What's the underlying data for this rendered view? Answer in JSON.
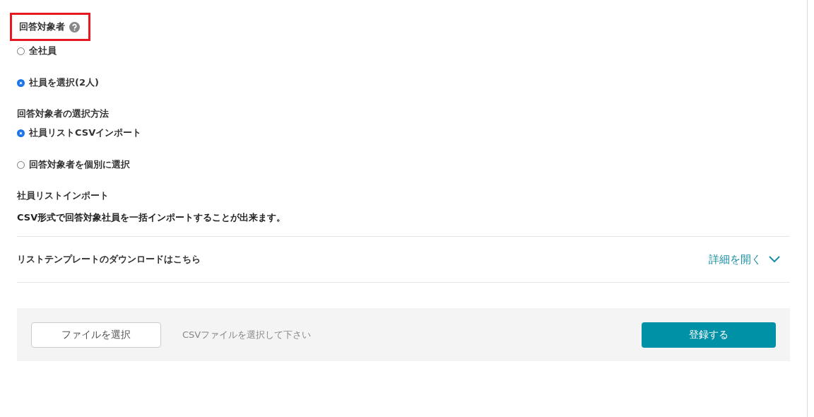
{
  "respondents": {
    "label": "回答対象者",
    "highlighted": true,
    "options": [
      {
        "label": "全社員",
        "selected": false
      },
      {
        "label": "社員を選択(2人)",
        "selected": true
      }
    ]
  },
  "selection_method": {
    "label": "回答対象者の選択方法",
    "options": [
      {
        "label": "社員リストCSVインポート",
        "selected": true
      },
      {
        "label": "回答対象者を個別に選択",
        "selected": false
      }
    ]
  },
  "import": {
    "title": "社員リストインポート",
    "description": "CSV形式で回答対象社員を一括インポートすることが出来ます。",
    "template": {
      "label": "リストテンプレートのダウンロードはこちら",
      "toggle": "詳細を開く",
      "expanded": false
    },
    "file_button": "ファイルを選択",
    "file_status": "CSVファイルを選択して下さい",
    "submit": "登録する"
  }
}
